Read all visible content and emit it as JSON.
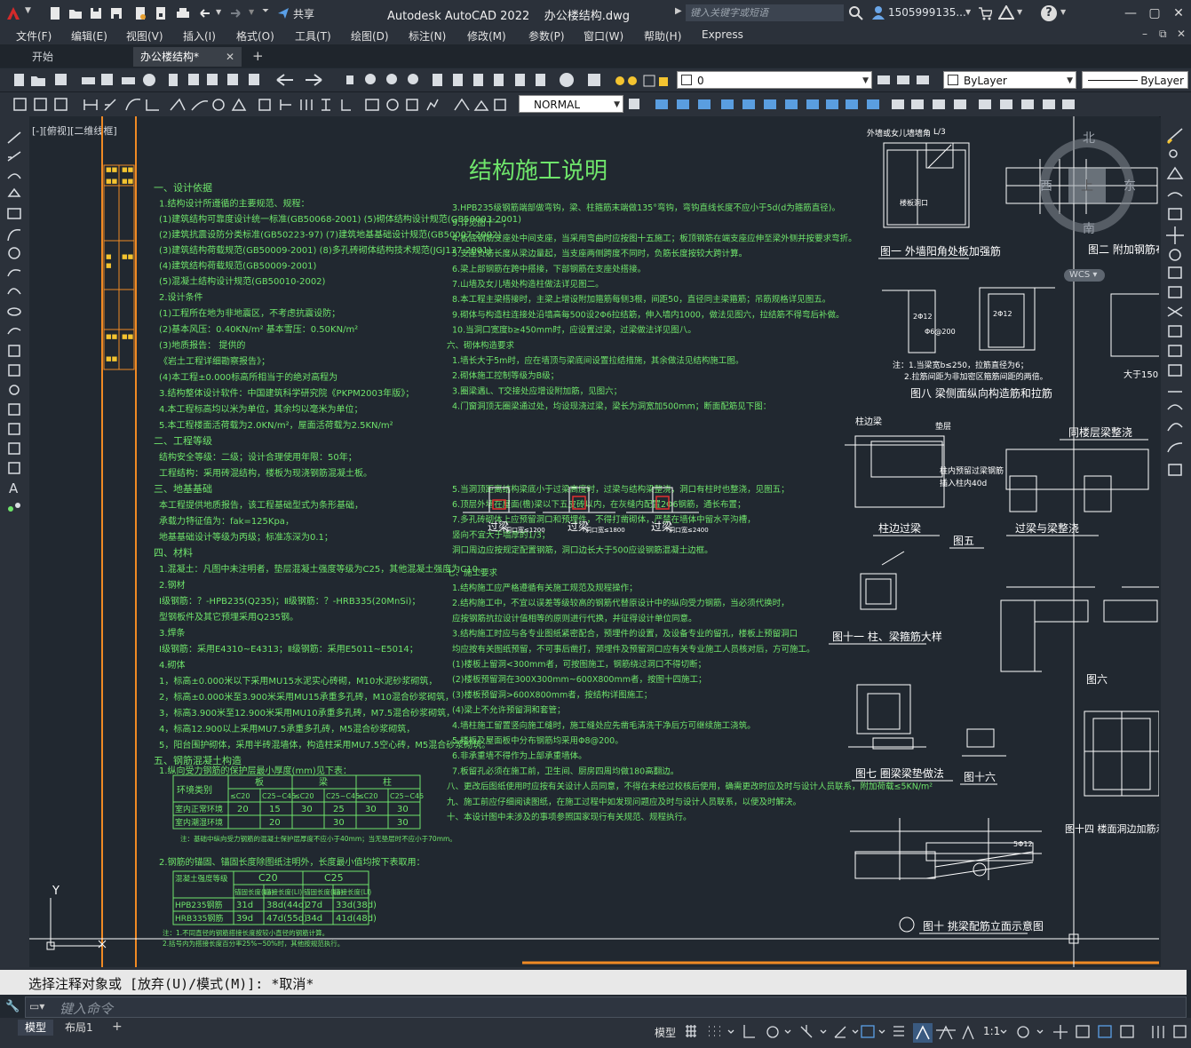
{
  "app": {
    "title": "Autodesk AutoCAD 2022",
    "document": "办公楼结构.dwg",
    "share_label": "共享",
    "search_placeholder": "键入关键字或短语",
    "user": "1505999135...",
    "help": "?"
  },
  "menu": [
    "文件(F)",
    "编辑(E)",
    "视图(V)",
    "插入(I)",
    "格式(O)",
    "工具(T)",
    "绘图(D)",
    "标注(N)",
    "修改(M)",
    "参数(P)",
    "窗口(W)",
    "帮助(H)",
    "Express"
  ],
  "tabs": [
    {
      "label": "开始"
    },
    {
      "label": "办公楼结构*"
    }
  ],
  "layer_dropdown": "0",
  "color_dropdown": "ByLayer",
  "linetype_dropdown": "ByLayer",
  "style_dropdown": "NORMAL",
  "viewport_label": "[-][俯视][二维线框]",
  "viewcube": {
    "north": "北",
    "south": "南",
    "west": "西",
    "east": "东",
    "top": "上",
    "wcs": "WCS"
  },
  "drawing": {
    "main_title": "结构施工说明",
    "col1": [
      "一、设计依据",
      "1.结构设计所遵循的主要规范、规程：",
      "(1)建筑结构可靠度设计统一标准(GB50068-2001)  (5)砌体结构设计规范(GB50003-2001)",
      "(2)建筑抗震设防分类标准(GB50223-97)  (7)建筑地基基础设计规范(GB50007-2002)",
      "(3)建筑结构荷载规范(GB50009-2001)  (8)多孔砖砌体结构技术规范(JGJ137-2001)",
      "(4)建筑结构荷载规范(GB50009-2001)",
      "(5)混凝土结构设计规范(GB50010-2002)",
      "2.设计条件",
      "(1)工程所在地为非地震区，不考虑抗震设防；",
      "(2)基本风压：0.40KN/m²  基本雪压：0.50KN/m²",
      "(3)地质报告：        提供的",
      "《岩土工程详细勘察报告》；",
      "(4)本工程±0.000标高所相当于的绝对高程为",
      "3.结构整体设计软件：中国建筑科学研究院《PKPM2003年版》；",
      "4.本工程标高均以米为单位，其余均以毫米为单位；",
      "5.本工程楼面活荷载为2.0KN/m²，屋面活荷载为2.5KN/m²",
      "二、工程等级",
      "结构安全等级：二级；设计合理使用年限：50年；",
      "工程结构：采用砖混结构，楼板为现浇钢筋混凝土板。",
      "三、地基基础",
      "本工程提供地质报告，该工程基础型式为条形基础，",
      "承载力特征值为：fak=125Kpa，",
      "地基基础设计等级为丙级；标准冻深为0.1；",
      "四、材料",
      "1.混凝土：凡图中未注明者，垫层混凝土强度等级为C25，其他混凝土强度为C10。",
      "2.钢材",
      "Ⅰ级钢筋：？-HPB235(Q235)；Ⅱ级钢筋：？-HRB335(20MnSi)；",
      "型钢板件及其它预埋采用Q235钢。",
      "3.焊条",
      "Ⅰ级钢筋：采用E4310~E4313；Ⅱ级钢筋：采用E5011~E5014；",
      "4.砌体",
      "1，标高±0.000米以下采用MU15水泥实心砖砌，M10水泥砂浆砌筑，",
      "2，标高±0.000米至3.900米采用MU15承重多孔砖，M10混合砂浆砌筑，",
      "3，标高3.900米至12.900米采用MU10承重多孔砖，M7.5混合砂浆砌筑，",
      "4，标高12.900以上采用MU7.5承重多孔砖，M5混合砂浆砌筑，",
      "5，阳台围护砌体，采用半砖混墙体，构造柱采用MU7.5空心砖，M5混合砂浆砌筑。",
      "五、钢筋混凝土构造",
      "1.纵向受力钢筋的保护层最小厚度(mm)见下表："
    ],
    "table1": {
      "header": [
        "环境类别",
        "板",
        "梁",
        "柱"
      ],
      "sub": [
        "≤C20",
        "C25~C45",
        "≤C20",
        "C25~C45",
        "≤C20",
        "C25~C45"
      ],
      "rows": [
        {
          "label": "室内正常环境",
          "values": [
            "20",
            "15",
            "30",
            "25",
            "30",
            "30"
          ]
        },
        {
          "label": "室内潮湿环境",
          "values": [
            "",
            "20",
            "",
            "30",
            "",
            "30"
          ]
        }
      ],
      "note": "注：基础中纵向受力钢筋的混凝土保护层厚度不应小于40mm；当无垫层时不应小于70mm。"
    },
    "col1b": [
      "2.钢筋的锚固、锚固长度除图纸注明外，长度最小值均按下表取用："
    ],
    "table2": {
      "header": [
        "混凝土强度等级",
        "C20",
        "C25"
      ],
      "sub": [
        "锚固长度(La)",
        "搭接长度(Ll)",
        "锚固长度(La)",
        "搭接长度(Ll)"
      ],
      "rows": [
        {
          "label": "HPB235钢筋",
          "values": [
            "31d",
            "38d(44d)",
            "27d",
            "33d(38d)"
          ]
        },
        {
          "label": "HRB335钢筋",
          "values": [
            "39d",
            "47d(55d)",
            "34d",
            "41d(48d)"
          ]
        }
      ],
      "notes": [
        "注：1.不同直径的钢筋搭接长度按较小直径的钢筋计算。",
        "2.括号内为搭接长度百分率25%~50%时，其他按规范执行。"
      ]
    },
    "col2": [
      "3.HPB235级钢筋端部做弯钩，梁、柱箍筋末端做135°弯钩，弯钩直线长度不应小于5d(d为箍筋直径)。",
      "9.详见图十一；",
      "4.板底钢筋支座处中间支座，当采用弯曲时应按图十五施工；板顶钢筋在端支座应伸至梁外侧并按要求弯折。",
      "5.支座负筋长度从梁边量起，当支座两侧跨度不同时，负筋长度按较大跨计算。",
      "6.梁上部钢筋在跨中搭接，下部钢筋在支座处搭接。",
      "7.山墙及女儿墙处构造柱做法详见图二。",
      "8.本工程主梁搭接时，主梁上增设附加箍筋每侧3根，间距50，直径同主梁箍筋；吊筋规格详见图五。",
      "9.砌体与构造柱连接处沿墙高每500设2Φ6拉结筋，伸入墙内1000，做法见图六，拉结筋不得弯后补做。",
      "10.当洞口宽度b≥450mm时，应设置过梁，过梁做法详见图八。",
      "六、砌体构造要求",
      "1.墙长大于5m时，应在墙顶与梁底间设置拉结措施，其余做法见结构施工图。",
      "2.砌体施工控制等级为B级；",
      "3.圈梁遇L、T交接处应增设附加筋，见图六；",
      "4.门窗洞顶无圈梁通过处，均设现浇过梁，梁长为洞宽加500mm；断面配筋见下图：",
      "5.当洞顶距离结构梁底小于过梁高度时，过梁与结构梁整浇，洞口有柱时也整浇，见图五；",
      "6.顶层外墙在屋面(檐)梁以下五皮砖以内，在灰缝内配置2Φ6钢筋，通长布置；",
      "7.多孔砖砌体上应预留洞口和预埋件，不得打凿砌体，严禁在墙体中留水平沟槽，",
      "竖向不宜大于墙厚的1/3；",
      "洞口周边应按规定配置钢筋，洞口边长大于500应设钢筋混凝土边框。",
      "七、施工要求",
      "1.结构施工应严格遵循有关施工规范及规程操作；",
      "2.结构施工中，不宜以误差等级较高的钢筋代替原设计中的纵向受力钢筋，当必须代换时，",
      "应按钢筋抗拉设计值相等的原则进行代换，并征得设计单位同意。",
      "3.结构施工时应与各专业图纸紧密配合，预埋件的设置，及设备专业的留孔，楼板上预留洞口",
      "均应按有关图纸预留，不可事后凿打，预埋件及预留洞口应有关专业施工人员核对后，方可施工。",
      "(1)楼板上留洞<300mm者，可按图施工，钢筋绕过洞口不得切断；",
      "(2)楼板预留洞在300X300mm~600X800mm者，按图十四施工；",
      "(3)楼板预留洞>600X800mm者，按结构详图施工；",
      "(4)梁上不允许预留洞和套管；",
      "4.墙柱施工留置竖向施工缝时，施工缝处应先凿毛清洗干净后方可继续施工浇筑。",
      "5.楼板及屋面板中分布钢筋均采用Φ8@200。",
      "6.非承重墙不得作为上部承重墙体。",
      "7.板留孔必须在施工前，卫生间、厨房四周均做180高翻边。",
      "八、更改后图纸使用时应按有关设计人员同意，不得在未经过校核后使用，确需更改时应及时与设计人员联系，附加荷载≤5KN/m²",
      "九、施工前应仔细阅读图纸，在施工过程中如发现问题应及时与设计人员联系，以便及时解决。",
      "十、本设计图中未涉及的事项参照国家现行有关规范、规程执行。"
    ],
    "lintel_labels": [
      "过梁",
      "过梁",
      "过梁"
    ],
    "lintel_sub": [
      "洞口宽≤1200",
      "洞口宽≤1800",
      "洞口宽≤2400"
    ],
    "figs": {
      "fig1": "图一 外墙阳角处板加强筋",
      "fig2": "图二 附加钢筋布置图",
      "fig8": "图八 梁侧面纵向构造筋和拉筋",
      "fig8notes": [
        "注：1.当梁宽b≤250，拉筋直径为6；",
        "2.拉筋间距为非加密区箍筋间距的两倍。"
      ],
      "fig_col_lintel": "柱边过梁",
      "fig5": "图五",
      "fig_lintel_pour": "过梁与梁整浇",
      "fig_stair": "同楼层梁整浇",
      "fig11": "图十一 柱、梁箍筋大样",
      "fig6": "图六",
      "fig7": "图七 圈梁梁垫做法",
      "fig16": "图十六",
      "fig14": "图十四 楼面洞边加筋示意",
      "fig10": "图十 挑梁配筋立面示意图",
      "small_labels": [
        "外墙或女儿墙墙角",
        "L/3",
        "楼板洞口",
        "大于150",
        "垫层",
        "柱内预留过梁钢筋",
        "插入柱内40d",
        "2Φ12",
        "2Φ12",
        "Φ6@200",
        "5Φ12"
      ]
    }
  },
  "cmd": {
    "history": "选择注释对象或 [放弃(U)/模式(M)]: *取消*",
    "placeholder": "键入命令"
  },
  "status": {
    "layout_tabs": [
      "模型",
      "布局1"
    ],
    "model_label": "模型",
    "scale": "1:1"
  },
  "colors": {
    "background": "#212830",
    "text": "#6fe56b",
    "drawing_white": "#ffffff",
    "orange": "#f08a24",
    "accent_blue": "#2a82da"
  }
}
